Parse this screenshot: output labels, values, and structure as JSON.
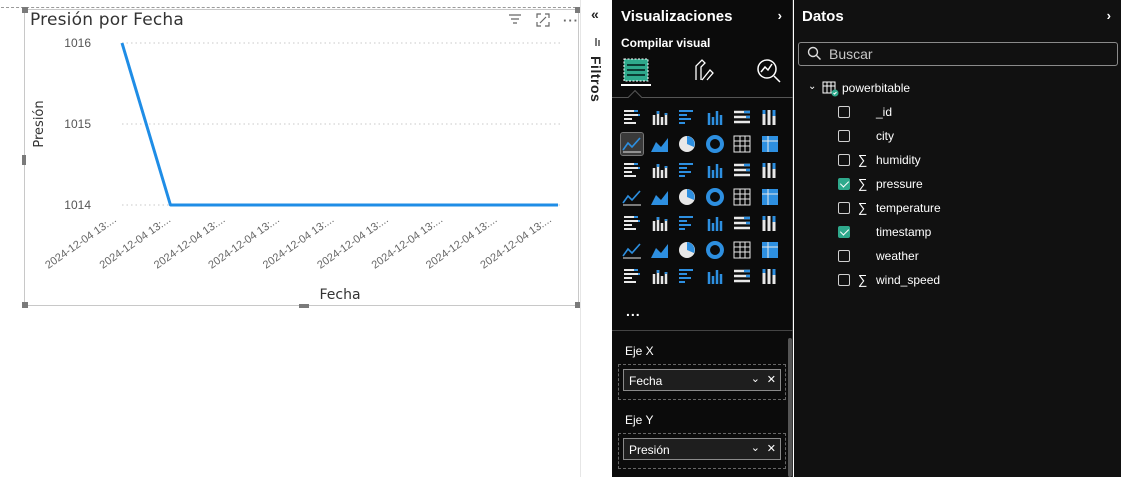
{
  "visual": {
    "title": "Presión por Fecha",
    "icons": [
      "filter-icon",
      "focus-mode-icon",
      "more-options-icon"
    ]
  },
  "chart_data": {
    "type": "line",
    "title": "Presión por Fecha",
    "xlabel": "Fecha",
    "ylabel": "Presión",
    "x": [
      "2024-12-04 13:...",
      "2024-12-04 13:...",
      "2024-12-04 13:...",
      "2024-12-04 13:...",
      "2024-12-04 13:...",
      "2024-12-04 13:...",
      "2024-12-04 13:...",
      "2024-12-04 13:...",
      "2024-12-04 13:..."
    ],
    "series": [
      {
        "values": [
          1016,
          1014,
          1014,
          1014,
          1014,
          1014,
          1014,
          1014,
          1014,
          1014
        ]
      }
    ],
    "yticks": [
      "1016",
      "1015",
      "1014"
    ],
    "ylim": [
      1014,
      1016
    ],
    "grid": true,
    "line_color": "#1f8de6"
  },
  "filters": {
    "label": "Filtros"
  },
  "visualizations": {
    "title": "Visualizaciones",
    "subtitle": "Compilar visual",
    "more": "...",
    "x_axis": {
      "label": "Eje X",
      "field": "Fecha"
    },
    "y_axis": {
      "label": "Eje Y",
      "field": "Presión"
    }
  },
  "data_pane": {
    "title": "Datos",
    "search_placeholder": "Buscar",
    "table": "powerbitable",
    "fields": [
      {
        "name": "_id",
        "sigma": false,
        "checked": false
      },
      {
        "name": "city",
        "sigma": false,
        "checked": false
      },
      {
        "name": "humidity",
        "sigma": true,
        "checked": false
      },
      {
        "name": "pressure",
        "sigma": true,
        "checked": true
      },
      {
        "name": "temperature",
        "sigma": true,
        "checked": false
      },
      {
        "name": "timestamp",
        "sigma": false,
        "checked": true
      },
      {
        "name": "weather",
        "sigma": false,
        "checked": false
      },
      {
        "name": "wind_speed",
        "sigma": true,
        "checked": false
      }
    ],
    "sigma_symbol": "∑"
  },
  "colors": {
    "accent": "#1f8de6",
    "check": "#2fa98c",
    "pane_bg": "#0b0b0b"
  }
}
